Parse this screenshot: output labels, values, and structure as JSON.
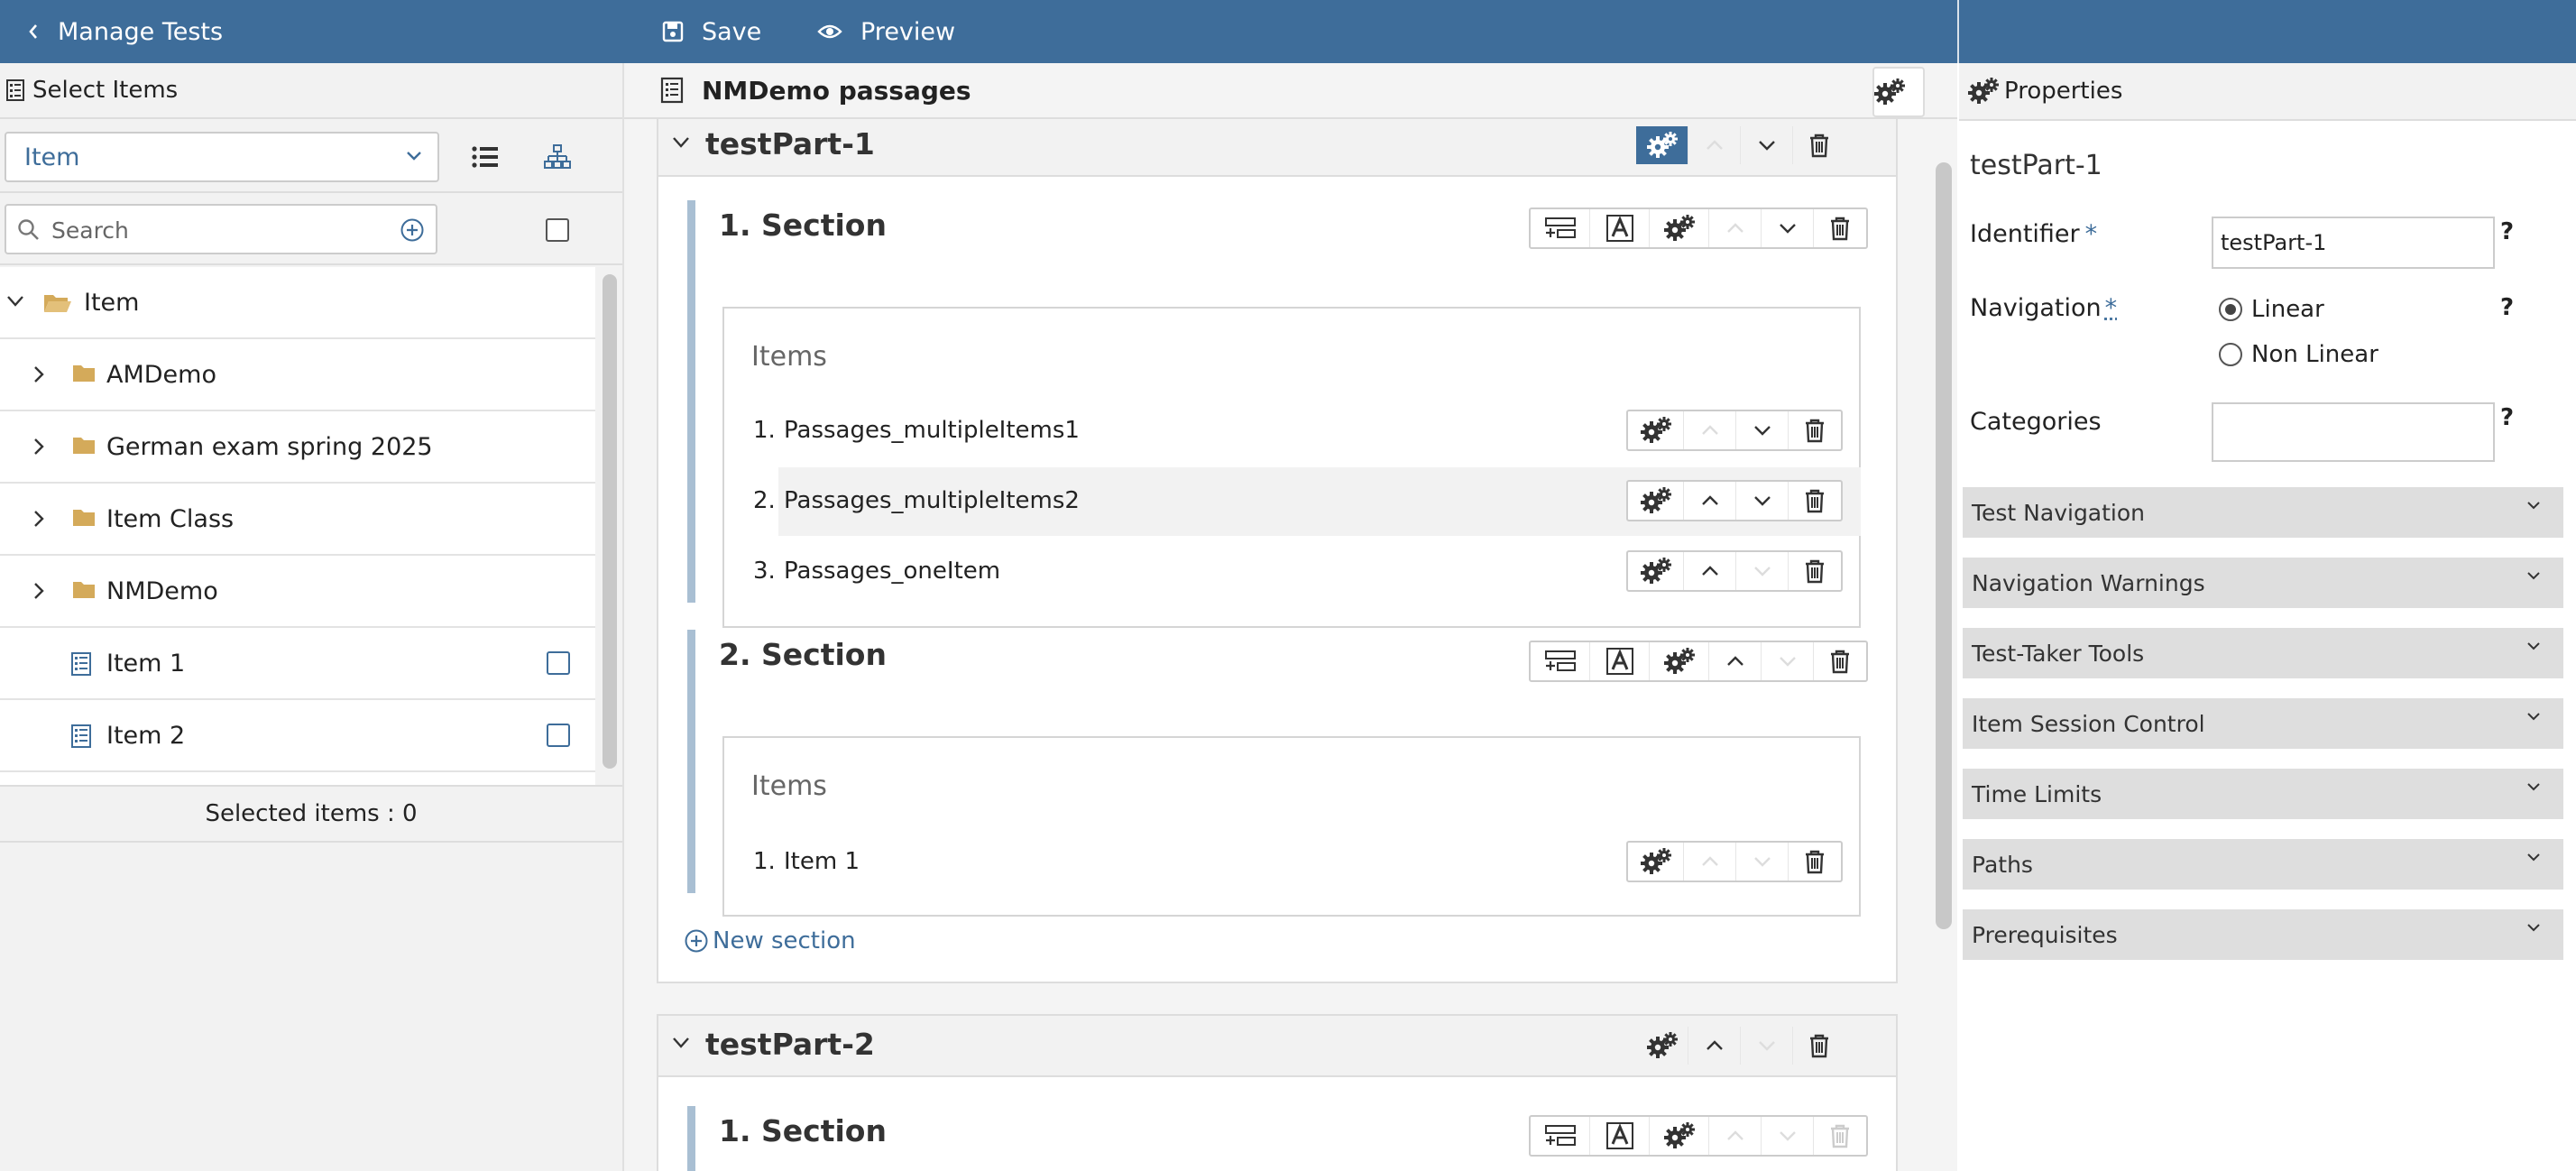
{
  "topbar": {
    "back_label": "Manage Tests",
    "save_label": "Save",
    "preview_label": "Preview"
  },
  "left_panel": {
    "title": "Select Items",
    "filter_value": "Item",
    "search_placeholder": "Search",
    "tree": [
      {
        "label": "Item",
        "type": "root-folder",
        "expanded": true
      },
      {
        "label": "AMDemo",
        "type": "folder"
      },
      {
        "label": "German exam spring 2025",
        "type": "folder"
      },
      {
        "label": "Item Class",
        "type": "folder"
      },
      {
        "label": "NMDemo",
        "type": "folder"
      },
      {
        "label": "Item 1",
        "type": "item"
      },
      {
        "label": "Item 2",
        "type": "item"
      }
    ],
    "selected_count": "Selected items : 0"
  },
  "center": {
    "title": "NMDemo passages",
    "test_parts": [
      {
        "title": "testPart-1",
        "sections": [
          {
            "title": "1. Section",
            "items_label": "Items",
            "items": [
              {
                "num": "1.",
                "label": "Passages_multipleItems1"
              },
              {
                "num": "2.",
                "label": "Passages_multipleItems2"
              },
              {
                "num": "3.",
                "label": "Passages_oneItem"
              }
            ]
          },
          {
            "title": "2. Section",
            "items_label": "Items",
            "items": [
              {
                "num": "1.",
                "label": "Item 1"
              }
            ]
          }
        ],
        "new_section_label": "New section"
      },
      {
        "title": "testPart-2",
        "sections": [
          {
            "title": "1. Section"
          }
        ]
      }
    ]
  },
  "right_panel": {
    "title": "Properties",
    "selected_title": "testPart-1",
    "identifier_label": "Identifier",
    "identifier_value": "testPart-1",
    "required_mark": "*",
    "navigation_label": "Navigation",
    "navigation_options": [
      "Linear",
      "Non Linear"
    ],
    "navigation_selected": "Linear",
    "categories_label": "Categories",
    "help_mark": "?",
    "accordions": [
      "Test Navigation",
      "Navigation Warnings",
      "Test-Taker Tools",
      "Item Session Control",
      "Time Limits",
      "Paths",
      "Prerequisites"
    ]
  },
  "colors": {
    "brand": "#3e6d9a",
    "folder": "#d4aa5a",
    "section_bar": "#a9bfd3"
  }
}
